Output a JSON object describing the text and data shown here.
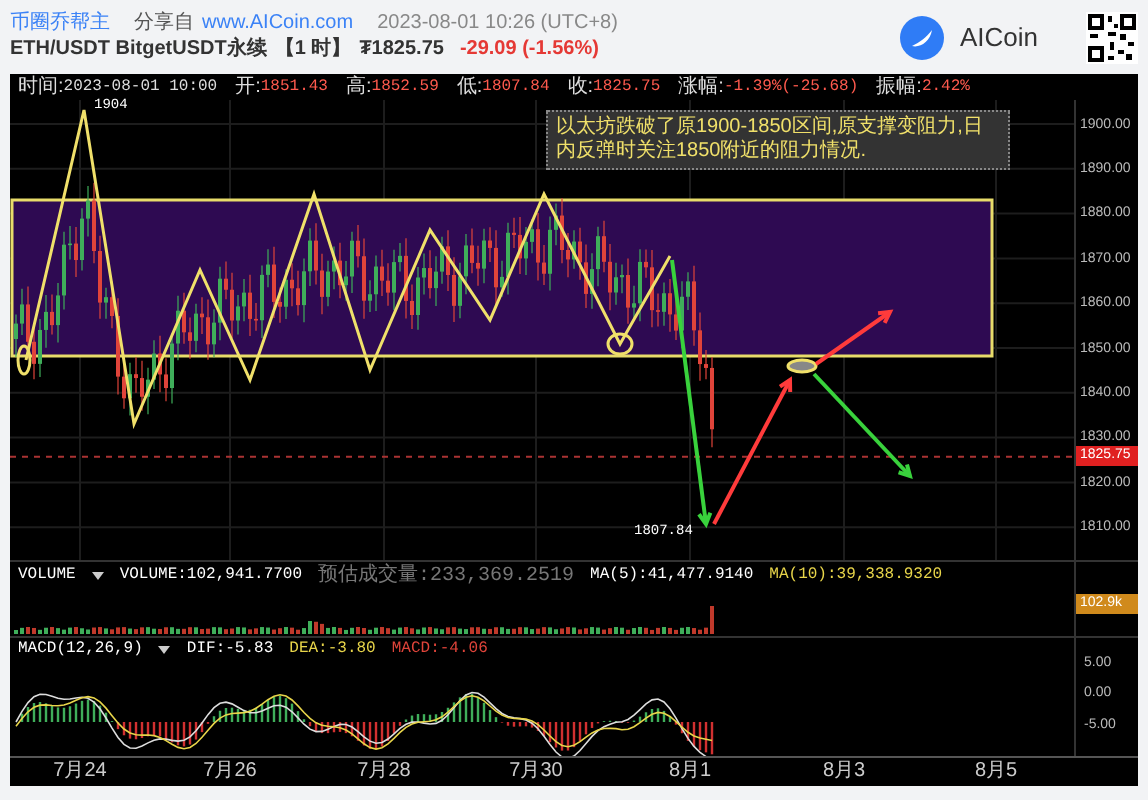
{
  "header": {
    "source": "币圈乔帮主",
    "share_label": "分享自",
    "share_url": "www.AICoin.com",
    "datetime": "2023-08-01 10:26 (UTC+8)",
    "symbol": "ETH/USDT BitgetUSDT永续",
    "interval": "【1 时】",
    "price": "₮1825.75",
    "change": "-29.09 (-1.56%)",
    "brand": "AICoin"
  },
  "info_bar": [
    {
      "label": "时间:",
      "value": "2023-08-01 10:00",
      "kind": "time"
    },
    {
      "label": "开:",
      "value": "1851.43",
      "kind": "price"
    },
    {
      "label": "高:",
      "value": "1852.59",
      "kind": "price"
    },
    {
      "label": "低:",
      "value": "1807.84",
      "kind": "price"
    },
    {
      "label": "收:",
      "value": "1825.75",
      "kind": "price"
    },
    {
      "label": "涨幅:",
      "value": "-1.39%(-25.68)",
      "kind": "price"
    },
    {
      "label": "振幅:",
      "value": "2.42%",
      "kind": "price"
    }
  ],
  "main_chart": {
    "annotation": "以太坊跌破了原1900-1850区间,原支撑变阻力,日内反弹时关注1850附近的阻力情况.",
    "high_label": "1904",
    "low_label": "1807.84",
    "current_price": "1825.75",
    "price_axis": [
      "1900.00",
      "1890.00",
      "1880.00",
      "1870.00",
      "1860.00",
      "1850.00",
      "1840.00",
      "1830.00",
      "1820.00",
      "1810.00"
    ]
  },
  "volume": {
    "title": "VOLUME",
    "volume": "VOLUME:102,941.7700",
    "estimate": "预估成交量:233,369.2519",
    "ma5": "MA(5):41,477.9140",
    "ma10": "MA(10):39,338.9320",
    "current": "102.9k"
  },
  "macd": {
    "title": "MACD(12,26,9)",
    "dif": "DIF:-5.83",
    "dea": "DEA:-3.80",
    "macd": "MACD:-4.06",
    "axis": [
      "5.00",
      "0.00",
      "-5.00"
    ]
  },
  "dates": [
    "7月24",
    "7月26",
    "7月28",
    "7月30",
    "8月1",
    "8月3",
    "8月5"
  ]
}
